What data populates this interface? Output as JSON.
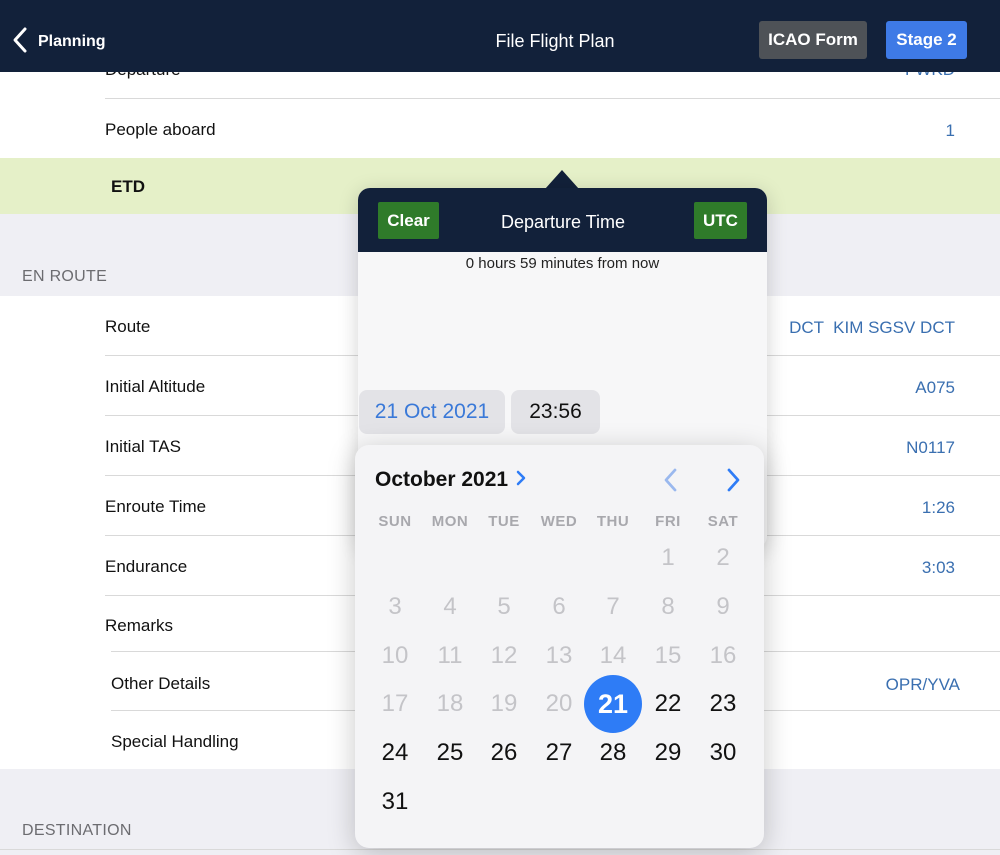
{
  "navbar": {
    "back_label": "Planning",
    "title": "File Flight Plan",
    "icao_button": "ICAO Form",
    "stage_button": "Stage 2"
  },
  "top_rows": {
    "departure_label": "Departure",
    "departure_value": "FWKD",
    "people_label": "People aboard",
    "people_value": "1",
    "etd_label": "ETD"
  },
  "en_route": {
    "header": "EN ROUTE",
    "rows": [
      {
        "label": "Route",
        "value": "DCT  KIM SGSV DCT"
      },
      {
        "label": "Initial Altitude",
        "value": "A075"
      },
      {
        "label": "Initial TAS",
        "value": "N0117"
      },
      {
        "label": "Enroute Time",
        "value": "1:26"
      },
      {
        "label": "Endurance",
        "value": "3:03"
      }
    ]
  },
  "remarks": {
    "label": "Remarks",
    "other_details_label": "Other Details",
    "other_details_value": "OPR/YVA",
    "special_handling_label": "Special Handling"
  },
  "destination": {
    "header": "DESTINATION"
  },
  "popover": {
    "clear_button": "Clear",
    "title": "Departure Time",
    "utc_button": "UTC",
    "subtitle": "0 hours 59 minutes from now",
    "date_value": "21 Oct 2021",
    "time_value": "23:56"
  },
  "calendar": {
    "month_label": "October 2021",
    "weekdays": [
      "SUN",
      "MON",
      "TUE",
      "WED",
      "THU",
      "FRI",
      "SAT"
    ],
    "first_weekday_index": 5,
    "days_in_month": 31,
    "selected_day": 21,
    "selectable_from_day": 21,
    "selected_color": "#2e7cf6"
  },
  "colors": {
    "navbar": "#12213a",
    "accent_blue": "#3e7ae6",
    "green_button": "#2f7b2a",
    "etd_highlight": "#e5f0c8",
    "value_blue": "#3a6fb0"
  }
}
